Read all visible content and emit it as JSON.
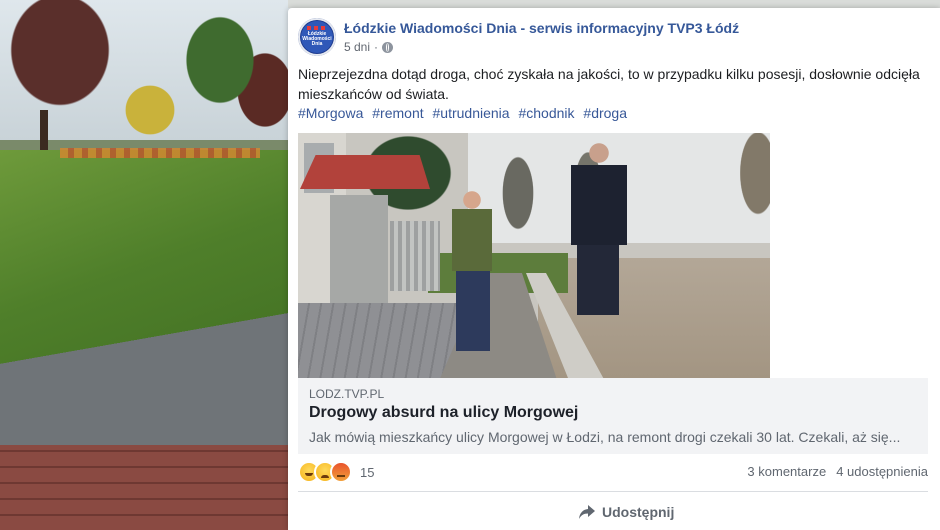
{
  "post": {
    "page_name": "Łódzkie Wiadomości Dnia - serwis informacyjny TVP3 Łódź",
    "avatar_text": "Łódzkie Wiadomości Dnia",
    "time": "5 dni",
    "separator": "·",
    "text": "Nieprzejezdna dotąd droga, choć zyskała na jakości, to w przypadku kilku posesji, dosłownie odcięła mieszkańców od świata.",
    "hashtags": [
      "#Morgowa",
      "#remont",
      "#utrudnienia",
      "#chodnik",
      "#droga"
    ]
  },
  "link_preview": {
    "domain": "LODZ.TVP.PL",
    "title": "Drogowy absurd na ulicy Morgowej",
    "description": "Jak mówią mieszkańcy ulicy Morgowej w Łodzi, na remont drogi czekali 30 lat. Czekali, aż się..."
  },
  "engagement": {
    "reactions": [
      "haha",
      "sad",
      "angry"
    ],
    "reaction_count": "15",
    "comments": "3 komentarze",
    "shares": "4 udostępnienia"
  },
  "actions": {
    "share_label": "Udostępnij"
  },
  "colors": {
    "link_blue": "#365899",
    "hashtag_blue": "#385898",
    "muted_text": "#606770"
  }
}
